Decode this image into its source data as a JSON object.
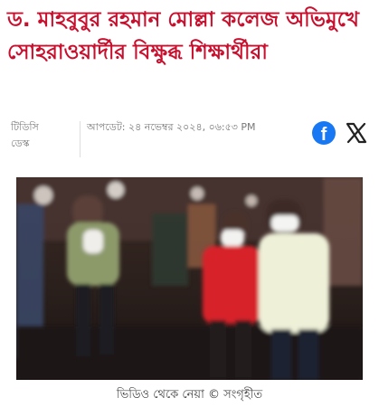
{
  "article": {
    "headline": "ড. মাহবুবুর রহমান মোল্লা কলেজ অভিমুখে সোহরাওয়ার্দীর বিক্ষুব্ধ শিক্ষার্থীরা",
    "author": "টিডিসি ডেস্ক",
    "updated": "আপডেট: ২৪ নভেম্বর ২০২৪, ০৬:৫৩ PM",
    "share": {
      "facebook_icon": "facebook-icon",
      "x_icon": "x-icon"
    },
    "image": {
      "description_icon": "protest-video-still",
      "caption": "ভিডিও থেকে নেয়া © সংগৃহীত"
    }
  },
  "colors": {
    "headline": "#c8102e",
    "facebook": "#1877f2",
    "x": "#222222",
    "photo_shirt_red": "#d8232a"
  }
}
